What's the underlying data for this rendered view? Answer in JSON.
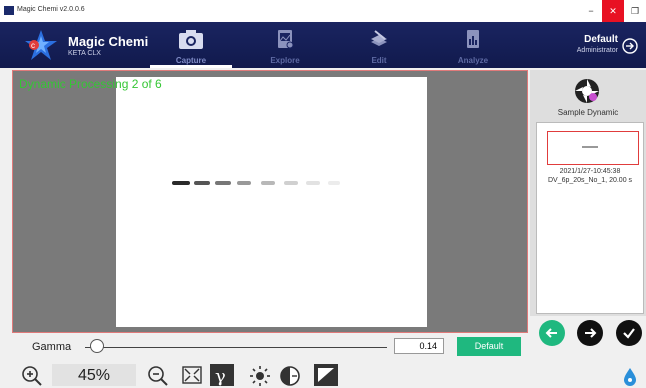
{
  "window": {
    "title": "Magic Chemi v2.0.0.6",
    "minimize": "−",
    "restore": "❐",
    "close": "✕"
  },
  "brand": {
    "name": "Magic Chemi",
    "subtitle": "KETA CLX"
  },
  "nav": [
    {
      "label": "Capture",
      "icon": "camera-icon",
      "active": true
    },
    {
      "label": "Explore",
      "icon": "folder-image-icon",
      "active": false
    },
    {
      "label": "Edit",
      "icon": "edit-layers-icon",
      "active": false
    },
    {
      "label": "Analyze",
      "icon": "analyze-document-icon",
      "active": false
    }
  ],
  "user": {
    "name": "Default",
    "role": "Administrator"
  },
  "main": {
    "status": "Dynamic Processing 2 of 6"
  },
  "side": {
    "sample_label": "Sample Dynamic",
    "thumb_date": "2021/1/27-10:45:38",
    "thumb_name": "DV_6p_20s_No_1, 20.00 s"
  },
  "gamma": {
    "label": "Gamma",
    "value": "0.14",
    "slider_fraction": 0.04,
    "default_label": "Default"
  },
  "zoom": {
    "value": "45%"
  },
  "colors": {
    "accent_green": "#1fb87f",
    "status_green": "#34c634",
    "header_blue": "#1a2460",
    "border_red": "#e07a7a"
  }
}
